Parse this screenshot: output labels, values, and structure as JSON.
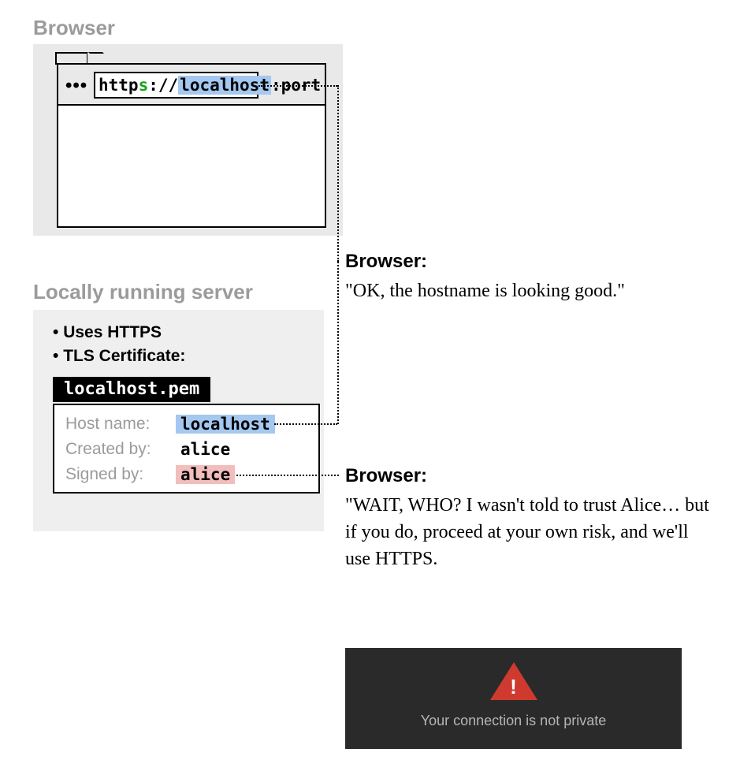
{
  "browser": {
    "title": "Browser",
    "url": {
      "prefix": "http",
      "s": "s",
      "sep": "://",
      "host": "localhost",
      "suffix": ":port"
    },
    "toolbar_dots": "•••"
  },
  "server": {
    "title": "Locally running server",
    "bullet1": "Uses HTTPS",
    "bullet2": "TLS Certificate:",
    "cert_file": "localhost.pem",
    "rows": {
      "host": {
        "label": "Host name:",
        "value": "localhost"
      },
      "created": {
        "label": "Created by:",
        "value": "alice"
      },
      "signed": {
        "label": "Signed by:",
        "value": "alice"
      }
    }
  },
  "commentary": {
    "c1": {
      "speaker": "Browser:",
      "text": "\"OK, the hostname is looking good.\""
    },
    "c2": {
      "speaker": "Browser:",
      "text": "\"WAIT, WHO? I wasn't told to trust Alice… but if you do, proceed at your own risk, and we'll use HTTPS."
    }
  },
  "warning": {
    "bang": "!",
    "msg": "Your connection is not private"
  }
}
